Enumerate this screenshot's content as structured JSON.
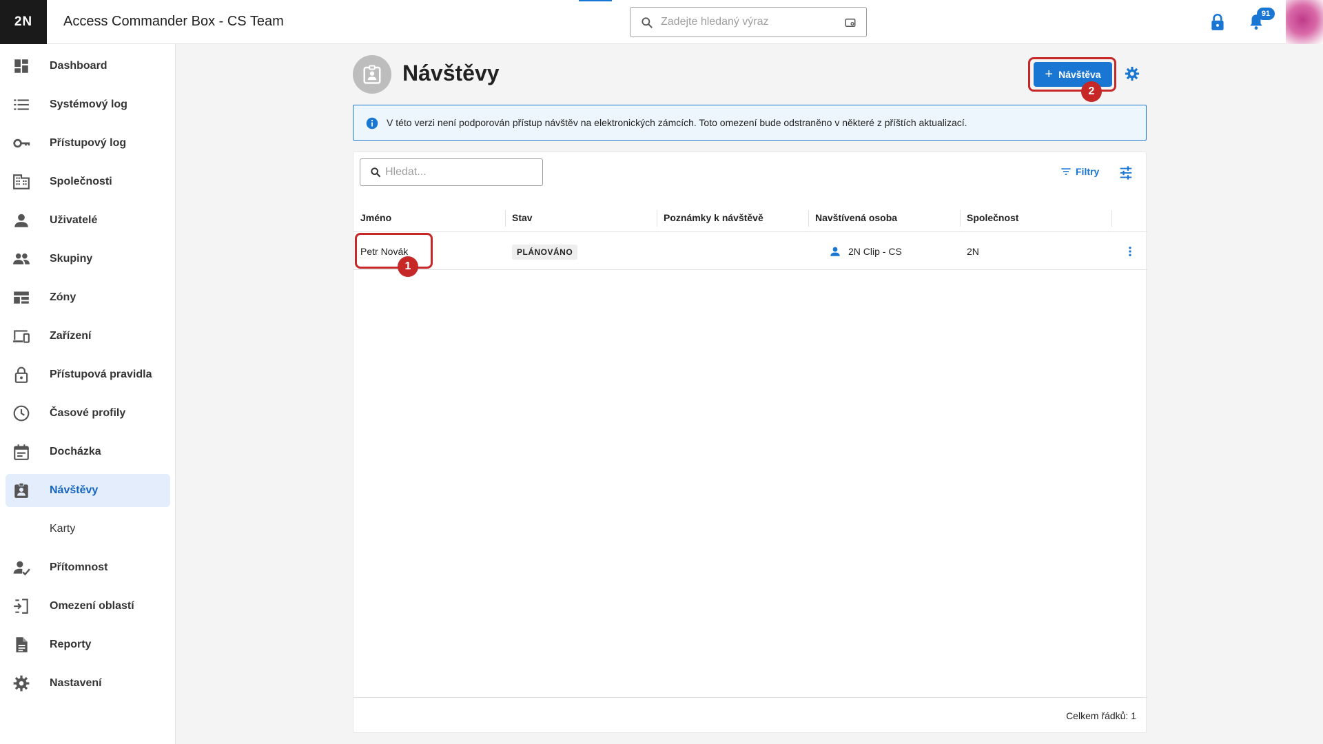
{
  "app": {
    "logo": "2N",
    "title": "Access Commander Box - CS Team"
  },
  "header": {
    "search_placeholder": "Zadejte hledaný výraz",
    "notifications_count": "91",
    "colors": {
      "accent": "#1976d2",
      "logo_bg": "#1a1a1a"
    }
  },
  "sidebar": {
    "items": [
      {
        "label": "Dashboard",
        "icon": "dashboard-icon"
      },
      {
        "label": "Systémový log",
        "icon": "list-icon"
      },
      {
        "label": "Přístupový log",
        "icon": "key-icon"
      },
      {
        "label": "Společnosti",
        "icon": "building-icon"
      },
      {
        "label": "Uživatelé",
        "icon": "person-icon"
      },
      {
        "label": "Skupiny",
        "icon": "group-icon"
      },
      {
        "label": "Zóny",
        "icon": "zones-icon"
      },
      {
        "label": "Zařízení",
        "icon": "devices-icon"
      },
      {
        "label": "Přístupová pravidla",
        "icon": "lock-icon"
      },
      {
        "label": "Časové profily",
        "icon": "clock-icon"
      },
      {
        "label": "Docházka",
        "icon": "calendar-icon"
      },
      {
        "label": "Návštěvy",
        "icon": "visitor-badge-icon",
        "active": true
      },
      {
        "label": "Karty",
        "sub": true
      },
      {
        "label": "Přítomnost",
        "icon": "person-check-icon"
      },
      {
        "label": "Omezení oblastí",
        "icon": "area-restriction-icon"
      },
      {
        "label": "Reporty",
        "icon": "report-icon"
      },
      {
        "label": "Nastavení",
        "icon": "gear-icon"
      }
    ]
  },
  "main": {
    "title": "Návštěvy",
    "add_button": "Návštěva",
    "info_message": "V této verzi není podporován přístup návštěv na elektronických zámcích. Toto omezení bude odstraněno v některé z příštích aktualizací.",
    "table": {
      "search_placeholder": "Hledat...",
      "filters_label": "Filtry",
      "columns": [
        "Jméno",
        "Stav",
        "Poznámky k návštěvě",
        "Navštívená osoba",
        "Společnost"
      ],
      "rows": [
        {
          "name": "Petr Novák",
          "status": "PLÁNOVÁNO",
          "notes": "",
          "visited_person": "2N Clip - CS",
          "company": "2N"
        }
      ],
      "footer_total": "Celkem řádků: 1"
    },
    "annotations": {
      "marker_1": "1",
      "marker_2": "2",
      "highlight_color": "#c62828"
    }
  }
}
